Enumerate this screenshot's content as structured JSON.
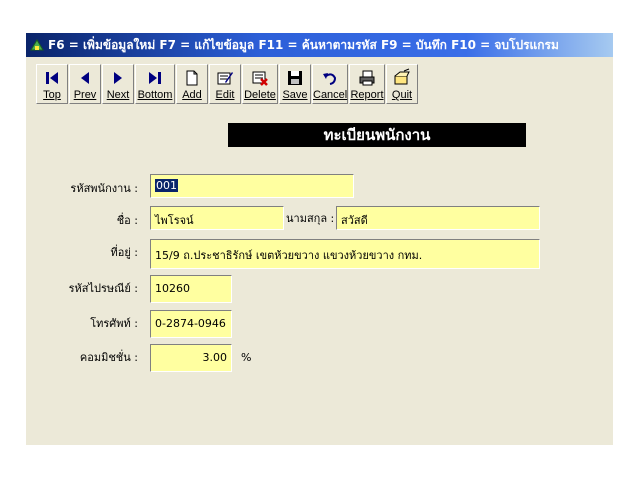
{
  "window": {
    "title": "F6 = เพิ่มข้อมูลใหม่ F7 = แก้ไขข้อมูล  F11 = ค้นหาตามรหัส F9 = บันทึก  F10 = จบโปรแกรม"
  },
  "toolbar": {
    "top": "Top",
    "prev": "Prev",
    "next": "Next",
    "bottom": "Bottom",
    "add": "Add",
    "edit": "Edit",
    "delete": "Delete",
    "save": "Save",
    "cancel": "Cancel",
    "report": "Report",
    "quit": "Quit"
  },
  "form": {
    "banner": "ทะเบียนพนักงาน",
    "emp_id_label": "รหัสพนักงาน :",
    "emp_id_value": "001",
    "name_label": "ชื่อ :",
    "name_value": "ไพโรจน์",
    "surname_label": "นามสกุล :",
    "surname_value": "สวัสดี",
    "address_label": "ที่อยู่ :",
    "address_value": "15/9 ถ.ประชาธิรักษ์ เขตห้วยขวาง แขวงห้วยขวาง กทม.",
    "zip_label": "รหัสไปรษณีย์ :",
    "zip_value": "10260",
    "phone_label": "โทรศัพท์ :",
    "phone_value": "0-2874-0946",
    "commission_label": "คอมมิชชั่น :",
    "commission_value": "3.00",
    "commission_unit": "%"
  },
  "colors": {
    "field_bg": "#ffffa0",
    "window_bg": "#ece9d8",
    "titlebar": "#0a246a",
    "banner_bg": "#000000"
  }
}
